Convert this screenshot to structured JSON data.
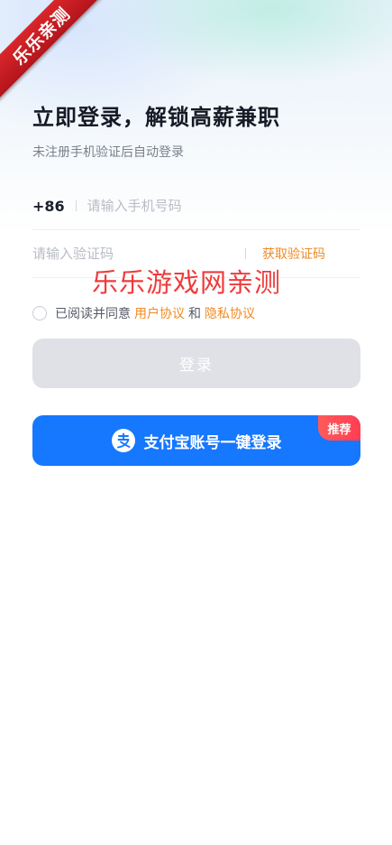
{
  "watermark_badge": "乐乐亲测",
  "header": {
    "title": "立即登录，解锁高薪兼职",
    "subtitle": "未注册手机验证后自动登录"
  },
  "phone": {
    "prefix": "+86",
    "placeholder": "请输入手机号码",
    "value": ""
  },
  "code": {
    "placeholder": "请输入验证码",
    "value": "",
    "get_code_label": "获取验证码"
  },
  "watermark_text": "乐乐游戏网亲测",
  "agreement": {
    "checked": false,
    "prefix": "已阅读并同意",
    "user_agreement": "用户协议",
    "and": "和",
    "privacy_agreement": "隐私协议"
  },
  "login_button": {
    "label": "登录"
  },
  "alipay_button": {
    "label": "支付宝账号一键登录",
    "badge": "推荐",
    "icon": "alipay-icon"
  },
  "colors": {
    "accent_orange": "#f08a24",
    "alipay_blue": "#1677ff",
    "badge_red": "#ff4a55",
    "ribbon_red": "#c81e24",
    "disabled_gray": "#dfe1e6",
    "watermark_red": "#ee3b3b"
  }
}
